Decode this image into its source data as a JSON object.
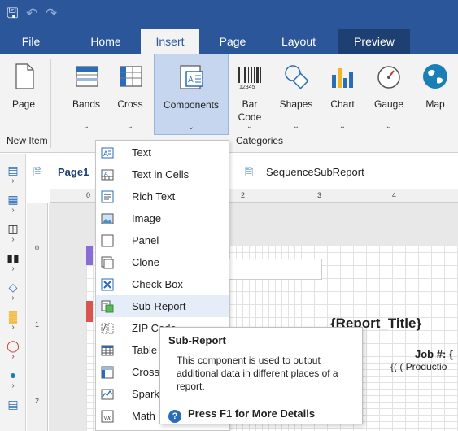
{
  "colors": {
    "accent": "#2b579a",
    "accent_dark": "#1d3f72",
    "selected": "#c5d6ee",
    "hover": "#e5edf8"
  },
  "quick_access": [
    {
      "name": "save-icon",
      "glyph": "🖫"
    },
    {
      "name": "undo-icon",
      "glyph": "↶"
    },
    {
      "name": "redo-icon",
      "glyph": "↷"
    }
  ],
  "tabs": {
    "file": "File",
    "home": "Home",
    "insert": "Insert",
    "page": "Page",
    "layout": "Layout",
    "preview": "Preview"
  },
  "ribbon": {
    "page": "Page",
    "bands": "Bands",
    "cross": "Cross",
    "components": "Components",
    "barcode_l1": "Bar",
    "barcode_l2": "Code",
    "shapes": "Shapes",
    "chart": "Chart",
    "gauge": "Gauge",
    "map": "Map",
    "group_new_item": "New Item",
    "group_categories": "Categories"
  },
  "page_tabs": {
    "page1": "Page1",
    "subreport": "SequenceSubReport"
  },
  "ruler": {
    "h": [
      "0",
      "1",
      "2",
      "3",
      "4"
    ],
    "v": [
      "0",
      "1",
      "2"
    ]
  },
  "report": {
    "title": "{Report_Title}",
    "job": "Job #: {",
    "production": "{( ( Productio"
  },
  "menu": {
    "text": "Text",
    "text_in_cells": "Text in Cells",
    "rich_text": "Rich Text",
    "image": "Image",
    "panel": "Panel",
    "clone": "Clone",
    "check_box": "Check Box",
    "sub_report": "Sub-Report",
    "zip_code": "ZIP Code",
    "table": "Table",
    "cross": "Cross",
    "sparkline": "Sparkline",
    "math": "Math"
  },
  "tooltip": {
    "title": "Sub-Report",
    "description": "This component is used to output additional data in different places of a report.",
    "help": "Press F1 for More Details"
  }
}
